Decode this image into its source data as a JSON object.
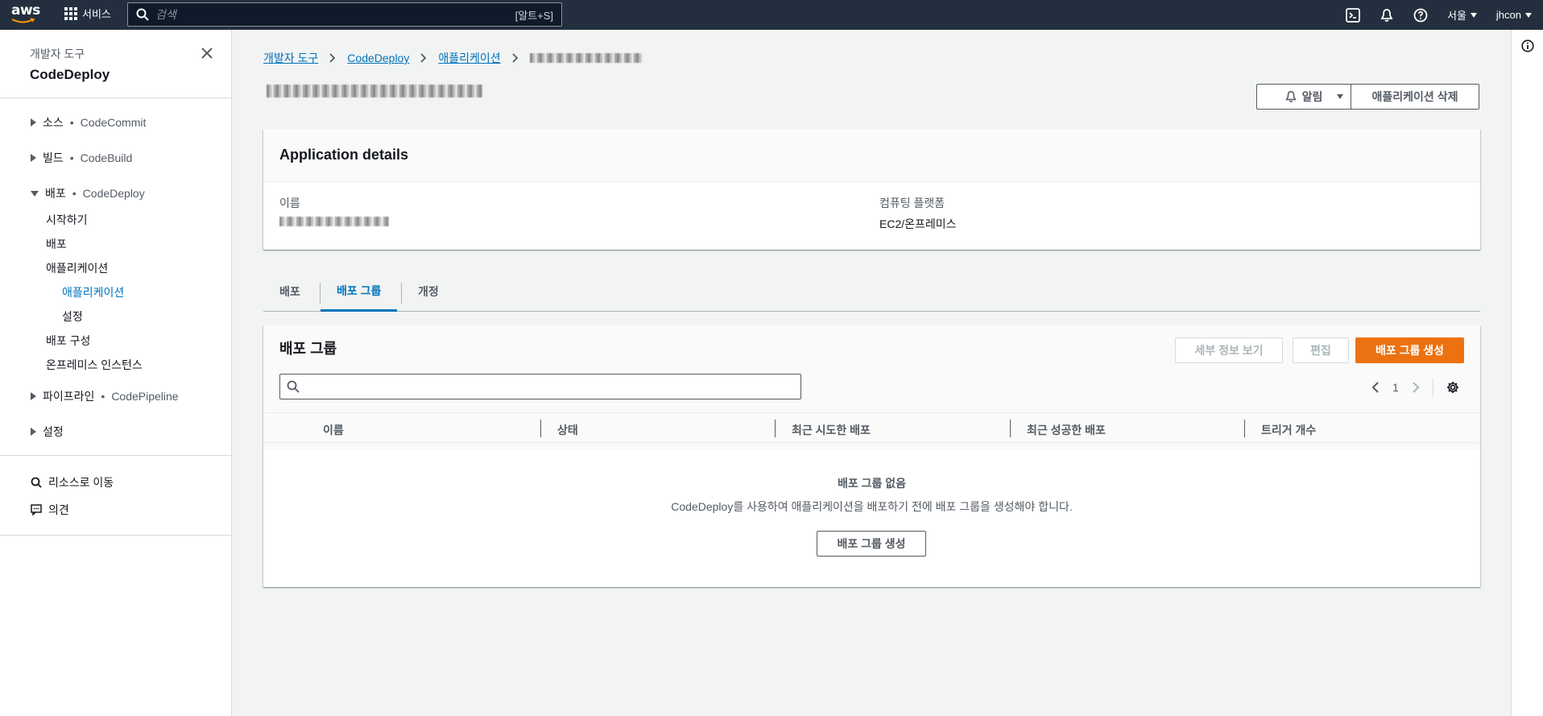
{
  "topbar": {
    "logo_text": "aws",
    "services_label": "서비스",
    "search_placeholder": "검색",
    "search_shortcut": "[알트+S]",
    "region": "서울",
    "user": "jhcon"
  },
  "sidenav": {
    "subtitle": "개발자 도구",
    "title": "CodeDeploy",
    "sections": [
      {
        "label": "소스",
        "service": "CodeCommit",
        "expanded": false
      },
      {
        "label": "빌드",
        "service": "CodeBuild",
        "expanded": false
      },
      {
        "label": "배포",
        "service": "CodeDeploy",
        "expanded": true
      },
      {
        "label": "파이프라인",
        "service": "CodePipeline",
        "expanded": false
      },
      {
        "label": "설정",
        "service": "",
        "expanded": false
      }
    ],
    "deploy_items": {
      "getting_started": "시작하기",
      "deployments": "배포",
      "applications": "애플리케이션",
      "applications_sub": "애플리케이션",
      "settings_sub": "설정",
      "deployment_configs": "배포 구성",
      "onprem": "온프레미스 인스턴스"
    },
    "go_to_resource": "리소스로 이동",
    "feedback": "의견",
    "bullet": "•"
  },
  "breadcrumb": {
    "items": [
      "개발자 도구",
      "CodeDeploy",
      "애플리케이션"
    ]
  },
  "header": {
    "notify_button": "알림",
    "delete_button": "애플리케이션 삭제"
  },
  "details": {
    "title": "Application details",
    "name_label": "이름",
    "platform_label": "컴퓨팅 플랫폼",
    "platform_value": "EC2/온프레미스"
  },
  "tabs": [
    "배포",
    "배포 그룹",
    "개정"
  ],
  "deployment_groups": {
    "title": "배포 그룹",
    "view_details_button": "세부 정보 보기",
    "edit_button": "편집",
    "create_button": "배포 그룹 생성",
    "page_number": "1",
    "columns": [
      "이름",
      "상태",
      "최근 시도한 배포",
      "최근 성공한 배포",
      "트리거 개수"
    ],
    "empty_title": "배포 그룹 없음",
    "empty_desc": "CodeDeploy를 사용하여 애플리케이션을 배포하기 전에 배포 그룹을 생성해야 합니다.",
    "empty_create_button": "배포 그룹 생성"
  },
  "colors": {
    "topbar": "#232f3e",
    "link": "#0073bb",
    "primary": "#ec7211"
  }
}
